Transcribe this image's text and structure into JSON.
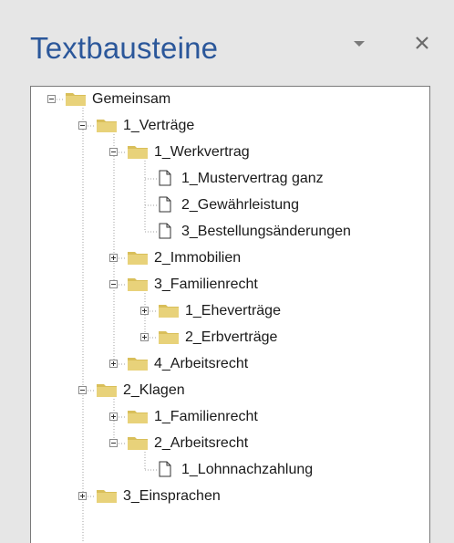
{
  "pane": {
    "title": "Textbausteine",
    "dropdown_icon": "caret-down-icon",
    "close_icon": "close-icon"
  },
  "tree": {
    "nodes": [
      {
        "label": "Gemeinsam",
        "level": 0,
        "type": "folder",
        "state": "expanded"
      },
      {
        "label": "1_Verträge",
        "level": 1,
        "type": "folder",
        "state": "expanded"
      },
      {
        "label": "1_Werkvertrag",
        "level": 2,
        "type": "folder",
        "state": "expanded"
      },
      {
        "label": "1_Mustervertrag ganz",
        "level": 3,
        "type": "document"
      },
      {
        "label": "2_Gewährleistung",
        "level": 3,
        "type": "document"
      },
      {
        "label": "3_Bestellungsänderungen",
        "level": 3,
        "type": "document"
      },
      {
        "label": "2_Immobilien",
        "level": 2,
        "type": "folder",
        "state": "collapsed"
      },
      {
        "label": "3_Familienrecht",
        "level": 2,
        "type": "folder",
        "state": "expanded"
      },
      {
        "label": "1_Eheverträge",
        "level": 3,
        "type": "folder",
        "state": "collapsed"
      },
      {
        "label": "2_Erbverträge",
        "level": 3,
        "type": "folder",
        "state": "collapsed"
      },
      {
        "label": "4_Arbeitsrecht",
        "level": 2,
        "type": "folder",
        "state": "collapsed"
      },
      {
        "label": "2_Klagen",
        "level": 1,
        "type": "folder",
        "state": "expanded"
      },
      {
        "label": "1_Familienrecht",
        "level": 2,
        "type": "folder",
        "state": "collapsed"
      },
      {
        "label": "2_Arbeitsrecht",
        "level": 2,
        "type": "folder",
        "state": "expanded"
      },
      {
        "label": "1_Lohnnachzahlung",
        "level": 3,
        "type": "document"
      },
      {
        "label": "3_Einsprachen",
        "level": 1,
        "type": "folder",
        "state": "collapsed"
      }
    ]
  },
  "colors": {
    "title": "#2b579a",
    "folder": "#e8d27a",
    "folder_shade": "#d9bf5a",
    "background": "#e6e6e6",
    "tree_background": "#ffffff"
  }
}
